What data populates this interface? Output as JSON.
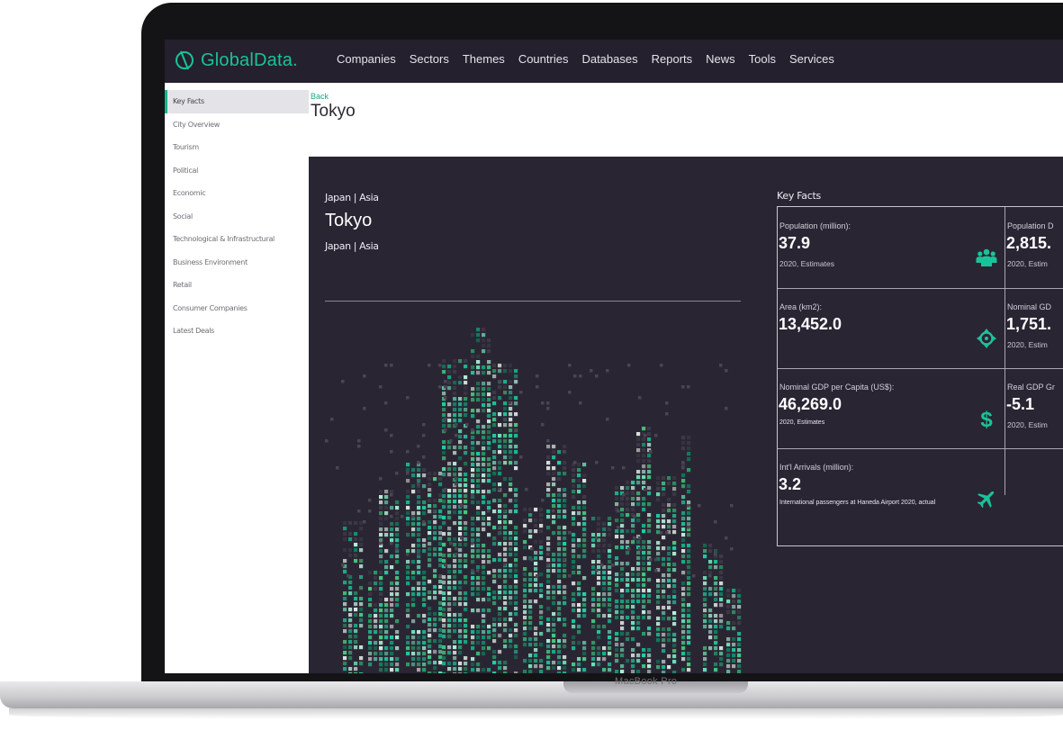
{
  "device": {
    "model": "MacBook Pro"
  },
  "brand": {
    "name": "GlobalData.",
    "accent": "#19c39a"
  },
  "nav": {
    "items": [
      "Companies",
      "Sectors",
      "Themes",
      "Countries",
      "Databases",
      "Reports",
      "News",
      "Tools",
      "Services"
    ]
  },
  "sidebar": {
    "items": [
      {
        "label": "Key Facts",
        "active": true
      },
      {
        "label": "City Overview"
      },
      {
        "label": "Tourism"
      },
      {
        "label": "Political"
      },
      {
        "label": "Economic"
      },
      {
        "label": "Social"
      },
      {
        "label": "Technological & Infrastructural"
      },
      {
        "label": "Business Environment"
      },
      {
        "label": "Retail"
      },
      {
        "label": "Consumer Companies"
      },
      {
        "label": "Latest Deals"
      }
    ]
  },
  "header": {
    "back": "Back",
    "title": "Tokyo"
  },
  "overview": {
    "location": "Japan | Asia",
    "city": "Tokyo",
    "location_sub": "Japan | Asia"
  },
  "key_facts": {
    "heading": "Key Facts",
    "cards": [
      {
        "label": "Population (million):",
        "value": "37.9",
        "note": "2020, Estimates",
        "icon": "people-icon"
      },
      {
        "label": "Population D",
        "value": "2,815.",
        "note": "2020, Estim"
      },
      {
        "label": "Area (km2):",
        "value": "13,452.0",
        "note": "",
        "icon": "crosshair-icon"
      },
      {
        "label": "Nominal GD",
        "value": "1,751.",
        "note": "2020, Estim"
      },
      {
        "label": "Nominal GDP per Capita (US$):",
        "value": "46,269.0",
        "note": "2020, Estimates",
        "icon": "dollar-icon"
      },
      {
        "label": "Real GDP Gr",
        "value": "-5.1",
        "note": "2020, Estim"
      },
      {
        "label": "Int'l Arrivals (million):",
        "value": "3.2",
        "note": "International passengers at Haneda Airport 2020, actual",
        "icon": "airplane-icon"
      }
    ]
  }
}
